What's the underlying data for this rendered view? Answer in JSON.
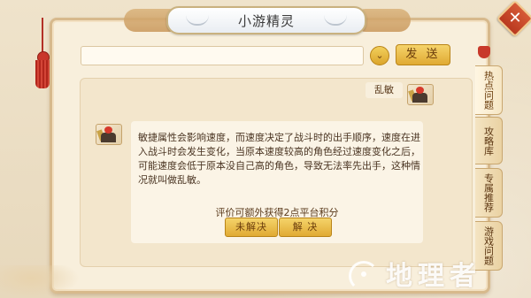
{
  "window": {
    "title": "小游精灵",
    "close_icon": "close-icon"
  },
  "input_row": {
    "placeholder": "",
    "dropdown_icon": "chevron-down-icon",
    "send_label": "发 送"
  },
  "chat": {
    "user_message": "乱敏",
    "bot_message": "敏捷属性会影响速度，而速度决定了战斗时的出手顺序，速度在进入战斗时会发生变化，当原本速度较高的角色经过速度变化之后，可能速度会低于原本没自己高的角色，导致无法率先出手，这种情况就叫做乱敏。",
    "rating_prompt": "评价可额外获得2点平台积分",
    "unresolved_label": "未解决",
    "resolved_label": "解 决"
  },
  "tabs": [
    {
      "label": "热点问题",
      "active": true
    },
    {
      "label": "攻略库",
      "active": false
    },
    {
      "label": "专属推荐",
      "active": false
    },
    {
      "label": "游戏问题",
      "active": false
    }
  ],
  "watermark": {
    "text": "地理者",
    "icon": "logo-mark-icon"
  },
  "colors": {
    "accent": "#e0aa33",
    "close": "#c84a2e",
    "tassel": "#b3261c"
  }
}
